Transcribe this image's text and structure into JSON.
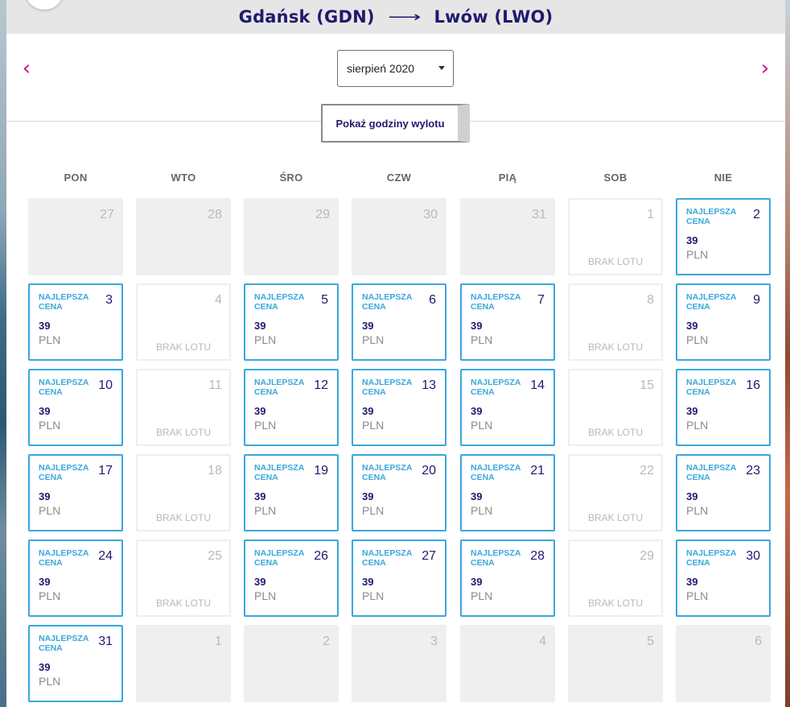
{
  "route": {
    "origin": "Gdańsk (GDN)",
    "arrow": "⟶",
    "destination": "Lwów (LWO)"
  },
  "nav": {
    "prev_icon": "‹",
    "next_icon": "›"
  },
  "month_select": {
    "value": "sierpień 2020"
  },
  "show_hours_button": "Pokaż godziny wylotu",
  "weekdays": [
    "PON",
    "WTO",
    "ŚRO",
    "CZW",
    "PIĄ",
    "SOB",
    "NIE"
  ],
  "labels": {
    "best_price": "NAJLEPSZA CENA",
    "currency": "PLN",
    "no_flight": "BRAK LOTU"
  },
  "colors": {
    "accent_blue": "#3aa7dc",
    "brand_navy": "#1f1a6e",
    "nav_magenta": "#c4127f"
  },
  "weeks": [
    [
      {
        "day": "27",
        "state": "empty"
      },
      {
        "day": "28",
        "state": "empty"
      },
      {
        "day": "29",
        "state": "empty"
      },
      {
        "day": "30",
        "state": "empty"
      },
      {
        "day": "31",
        "state": "empty"
      },
      {
        "day": "1",
        "state": "noflight"
      },
      {
        "day": "2",
        "state": "price",
        "price": "39"
      }
    ],
    [
      {
        "day": "3",
        "state": "price",
        "price": "39"
      },
      {
        "day": "4",
        "state": "noflight"
      },
      {
        "day": "5",
        "state": "price",
        "price": "39"
      },
      {
        "day": "6",
        "state": "price",
        "price": "39"
      },
      {
        "day": "7",
        "state": "price",
        "price": "39"
      },
      {
        "day": "8",
        "state": "noflight"
      },
      {
        "day": "9",
        "state": "price",
        "price": "39"
      }
    ],
    [
      {
        "day": "10",
        "state": "price",
        "price": "39"
      },
      {
        "day": "11",
        "state": "noflight"
      },
      {
        "day": "12",
        "state": "price",
        "price": "39"
      },
      {
        "day": "13",
        "state": "price",
        "price": "39"
      },
      {
        "day": "14",
        "state": "price",
        "price": "39"
      },
      {
        "day": "15",
        "state": "noflight"
      },
      {
        "day": "16",
        "state": "price",
        "price": "39"
      }
    ],
    [
      {
        "day": "17",
        "state": "price",
        "price": "39"
      },
      {
        "day": "18",
        "state": "noflight"
      },
      {
        "day": "19",
        "state": "price",
        "price": "39"
      },
      {
        "day": "20",
        "state": "price",
        "price": "39"
      },
      {
        "day": "21",
        "state": "price",
        "price": "39"
      },
      {
        "day": "22",
        "state": "noflight"
      },
      {
        "day": "23",
        "state": "price",
        "price": "39"
      }
    ],
    [
      {
        "day": "24",
        "state": "price",
        "price": "39"
      },
      {
        "day": "25",
        "state": "noflight"
      },
      {
        "day": "26",
        "state": "price",
        "price": "39"
      },
      {
        "day": "27",
        "state": "price",
        "price": "39"
      },
      {
        "day": "28",
        "state": "price",
        "price": "39"
      },
      {
        "day": "29",
        "state": "noflight"
      },
      {
        "day": "30",
        "state": "price",
        "price": "39"
      }
    ],
    [
      {
        "day": "31",
        "state": "price",
        "price": "39"
      },
      {
        "day": "1",
        "state": "empty"
      },
      {
        "day": "2",
        "state": "empty"
      },
      {
        "day": "3",
        "state": "empty"
      },
      {
        "day": "4",
        "state": "empty"
      },
      {
        "day": "5",
        "state": "empty"
      },
      {
        "day": "6",
        "state": "empty"
      }
    ]
  ]
}
